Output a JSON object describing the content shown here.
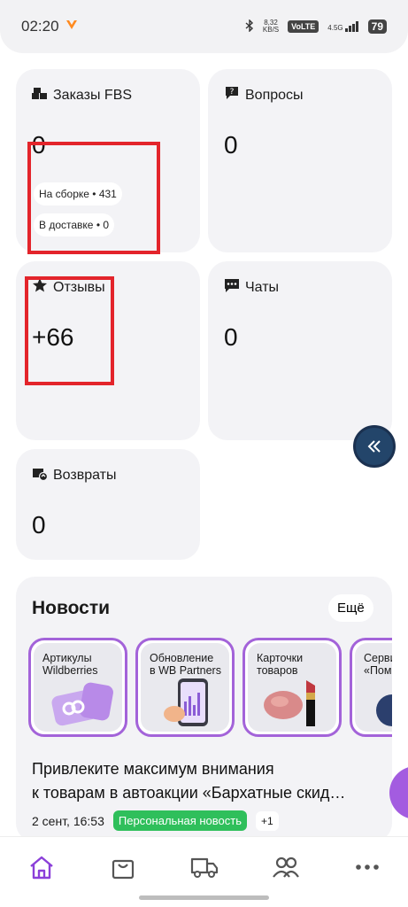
{
  "status": {
    "time": "02:20",
    "speed_value": "8,32",
    "speed_unit": "KB/S",
    "volte": "VoLTE",
    "network": "4.5G",
    "battery": "79"
  },
  "cards": {
    "orders": {
      "title": "Заказы FBS",
      "value": "0",
      "assembling": "На сборке • 431",
      "delivering": "В доставке • 0"
    },
    "questions": {
      "title": "Вопросы",
      "value": "0"
    },
    "reviews": {
      "title": "Отзывы",
      "value": "+66"
    },
    "chats": {
      "title": "Чаты",
      "value": "0"
    },
    "returns": {
      "title": "Возвраты",
      "value": "0"
    }
  },
  "news": {
    "title": "Новости",
    "more_label": "Ещё",
    "stories": [
      {
        "label": "Артикулы\nWildberries"
      },
      {
        "label": "Обновление\nв WB Partners"
      },
      {
        "label": "Карточки\nтоваров"
      },
      {
        "label": "Серви\n«Пом"
      }
    ],
    "headline_line1": "Привлеките максимум внимания",
    "headline_line2": "к товарам в автоакции «Бархатные скид…",
    "date": "2 сент, 16:53",
    "tag": "Персональная новость",
    "tag_more": "+1"
  },
  "nav": {
    "items": [
      "home-icon",
      "bag-icon",
      "truck-icon",
      "people-icon",
      "more-icon"
    ],
    "active_color": "#8b3fd9",
    "inactive_color": "#555555"
  },
  "colors": {
    "accent": "#a363d9",
    "highlight_box": "#e3242b",
    "tag_green": "#2fbf5b"
  }
}
